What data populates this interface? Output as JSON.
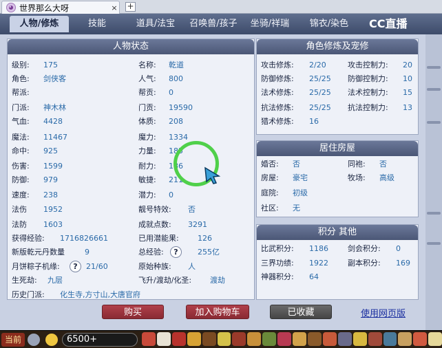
{
  "browser": {
    "tab_title": "世界那么大呀",
    "tab_close": "×",
    "new_tab": "+"
  },
  "nav": {
    "tabs": [
      "人物/修炼",
      "技能",
      "道具/法宝",
      "召唤兽/孩子",
      "坐骑/祥瑞",
      "锦衣/染色"
    ],
    "logo": "CC直播"
  },
  "status": {
    "title": "人物状态",
    "left": [
      {
        "k": "级别:",
        "v": "175"
      },
      {
        "k": "角色:",
        "v": "剑侠客"
      },
      {
        "k": "帮派:",
        "v": ""
      },
      {
        "k": "门派:",
        "v": "神木林"
      },
      {
        "k": "气血:",
        "v": "4428"
      },
      {
        "k": "魔法:",
        "v": "11467"
      },
      {
        "k": "命中:",
        "v": "925"
      },
      {
        "k": "伤害:",
        "v": "1599"
      },
      {
        "k": "防御:",
        "v": "979"
      },
      {
        "k": "速度:",
        "v": "238"
      },
      {
        "k": "法伤",
        "v": "1952"
      },
      {
        "k": "法防",
        "v": "1603"
      },
      {
        "k": "获得经验:",
        "v": "1716826661"
      },
      {
        "k": "新版乾元丹数量",
        "v": "9"
      },
      {
        "k": "月饼粽子机缘:",
        "v": "21/60",
        "help": "?"
      },
      {
        "k": "生死劫:",
        "v": "九层"
      },
      {
        "k": "历史门派:",
        "v": "化生寺,方寸山,大唐官府"
      }
    ],
    "right": [
      {
        "k": "名称:",
        "v": "乾道"
      },
      {
        "k": "人气:",
        "v": "800"
      },
      {
        "k": "帮贡:",
        "v": "0"
      },
      {
        "k": "门贡:",
        "v": "19590"
      },
      {
        "k": "体质:",
        "v": "208"
      },
      {
        "k": "魔力:",
        "v": "1334"
      },
      {
        "k": "力量:",
        "v": "185"
      },
      {
        "k": "耐力:",
        "v": "186"
      },
      {
        "k": "敏捷:",
        "v": "211"
      },
      {
        "k": "潜力:",
        "v": "0"
      },
      {
        "k": "靓号特效:",
        "v": "否"
      },
      {
        "k": "成就点数:",
        "v": "3291"
      },
      {
        "k": "已用潜能果:",
        "v": "126"
      },
      {
        "k": "总经验:",
        "v": "255亿",
        "help": "?"
      },
      {
        "k": "原始种族:",
        "v": "人"
      },
      {
        "k": "飞升/渡劫/化圣:",
        "v": "渡劫"
      }
    ]
  },
  "cultivation": {
    "title": "角色修炼及宠修",
    "rows": [
      {
        "k1": "攻击修炼:",
        "v1": "2/20",
        "k2": "攻击控制力:",
        "v2": "20"
      },
      {
        "k1": "防御修炼:",
        "v1": "25/25",
        "k2": "防御控制力:",
        "v2": "10"
      },
      {
        "k1": "法术修炼:",
        "v1": "25/25",
        "k2": "法术控制力:",
        "v2": "15"
      },
      {
        "k1": "抗法修炼:",
        "v1": "25/25",
        "k2": "抗法控制力:",
        "v2": "13"
      },
      {
        "k1": "猎术修炼:",
        "v1": "16",
        "k2": "",
        "v2": ""
      }
    ]
  },
  "house": {
    "title": "居住房屋",
    "rows": [
      {
        "k1": "婚否:",
        "v1": "否",
        "k2": "同袍:",
        "v2": "否"
      },
      {
        "k1": "房屋:",
        "v1": "豪宅",
        "k2": "牧场:",
        "v2": "高级"
      },
      {
        "k1": "庭院:",
        "v1": "初级",
        "k2": "",
        "v2": ""
      },
      {
        "k1": "社区:",
        "v1": "无",
        "k2": "",
        "v2": ""
      }
    ]
  },
  "score": {
    "title": "积分 其他",
    "rows": [
      {
        "k1": "比武积分:",
        "v1": "1186",
        "k2": "剑会积分:",
        "v2": "0"
      },
      {
        "k1": "三界功绩:",
        "v1": "1922",
        "k2": "副本积分:",
        "v2": "169"
      },
      {
        "k1": "神器积分:",
        "v1": "64",
        "k2": "",
        "v2": ""
      }
    ]
  },
  "actions": {
    "buy": "购买",
    "cart": "加入购物车",
    "collected": "已收藏",
    "web": "使用网页版"
  },
  "bottom": {
    "channel": "当前",
    "count": "6500+"
  }
}
